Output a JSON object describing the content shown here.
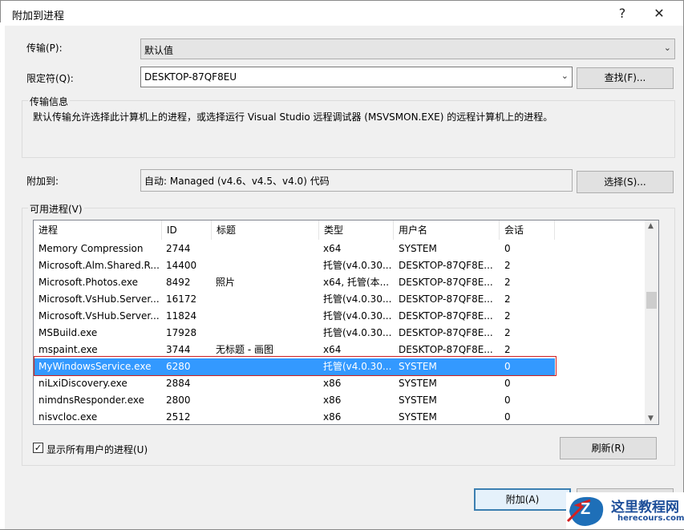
{
  "dialog": {
    "title": "附加到进程",
    "help": "?",
    "close": "✕"
  },
  "transport": {
    "label": "传输(P):",
    "value": "默认值"
  },
  "qualifier": {
    "label": "限定符(Q):",
    "value": "DESKTOP-87QF8EU",
    "find_button": "查找(F)..."
  },
  "transport_info": {
    "title": "传输信息",
    "text": "默认传输允许选择此计算机上的进程，或选择运行 Visual Studio 远程调试器 (MSVSMON.EXE) 的远程计算机上的进程。"
  },
  "attach_to": {
    "label": "附加到:",
    "value": "自动: Managed (v4.6、v4.5、v4.0) 代码",
    "select_button": "选择(S)..."
  },
  "processes": {
    "title": "可用进程(V)",
    "columns": [
      "进程",
      "ID",
      "标题",
      "类型",
      "用户名",
      "会话"
    ],
    "rows": [
      [
        "Memory Compression",
        "2744",
        "",
        "x64",
        "SYSTEM",
        "0"
      ],
      [
        "Microsoft.Alm.Shared.R...",
        "14400",
        "",
        "托管(v4.0.30...",
        "DESKTOP-87QF8E...",
        "2"
      ],
      [
        "Microsoft.Photos.exe",
        "8492",
        "照片",
        "x64, 托管(本...",
        "DESKTOP-87QF8E...",
        "2"
      ],
      [
        "Microsoft.VsHub.Server....",
        "16172",
        "",
        "托管(v4.0.30...",
        "DESKTOP-87QF8E...",
        "2"
      ],
      [
        "Microsoft.VsHub.Server....",
        "11824",
        "",
        "托管(v4.0.30...",
        "DESKTOP-87QF8E...",
        "2"
      ],
      [
        "MSBuild.exe",
        "17928",
        "",
        "托管(v4.0.30...",
        "DESKTOP-87QF8E...",
        "2"
      ],
      [
        "mspaint.exe",
        "3744",
        "无标题 - 画图",
        "x64",
        "DESKTOP-87QF8E...",
        "2"
      ],
      [
        "MyWindowsService.exe",
        "6280",
        "",
        "托管(v4.0.30...",
        "SYSTEM",
        "0"
      ],
      [
        "niLxiDiscovery.exe",
        "2884",
        "",
        "x86",
        "SYSTEM",
        "0"
      ],
      [
        "nimdnsResponder.exe",
        "2800",
        "",
        "x86",
        "SYSTEM",
        "0"
      ],
      [
        "nisvcloc.exe",
        "2512",
        "",
        "x86",
        "SYSTEM",
        "0"
      ]
    ],
    "selected_index": 7,
    "show_all_users": {
      "label": "显示所有用户的进程(U)",
      "checked": "✓"
    },
    "refresh_button": "刷新(R)"
  },
  "footer": {
    "attach_button": "附加(A)"
  },
  "watermark": {
    "text": "这里教程网",
    "url": "herecours.com",
    "glyph": "Z"
  },
  "colors": {
    "selection": "#3399ff",
    "highlight_box": "#d42020"
  }
}
